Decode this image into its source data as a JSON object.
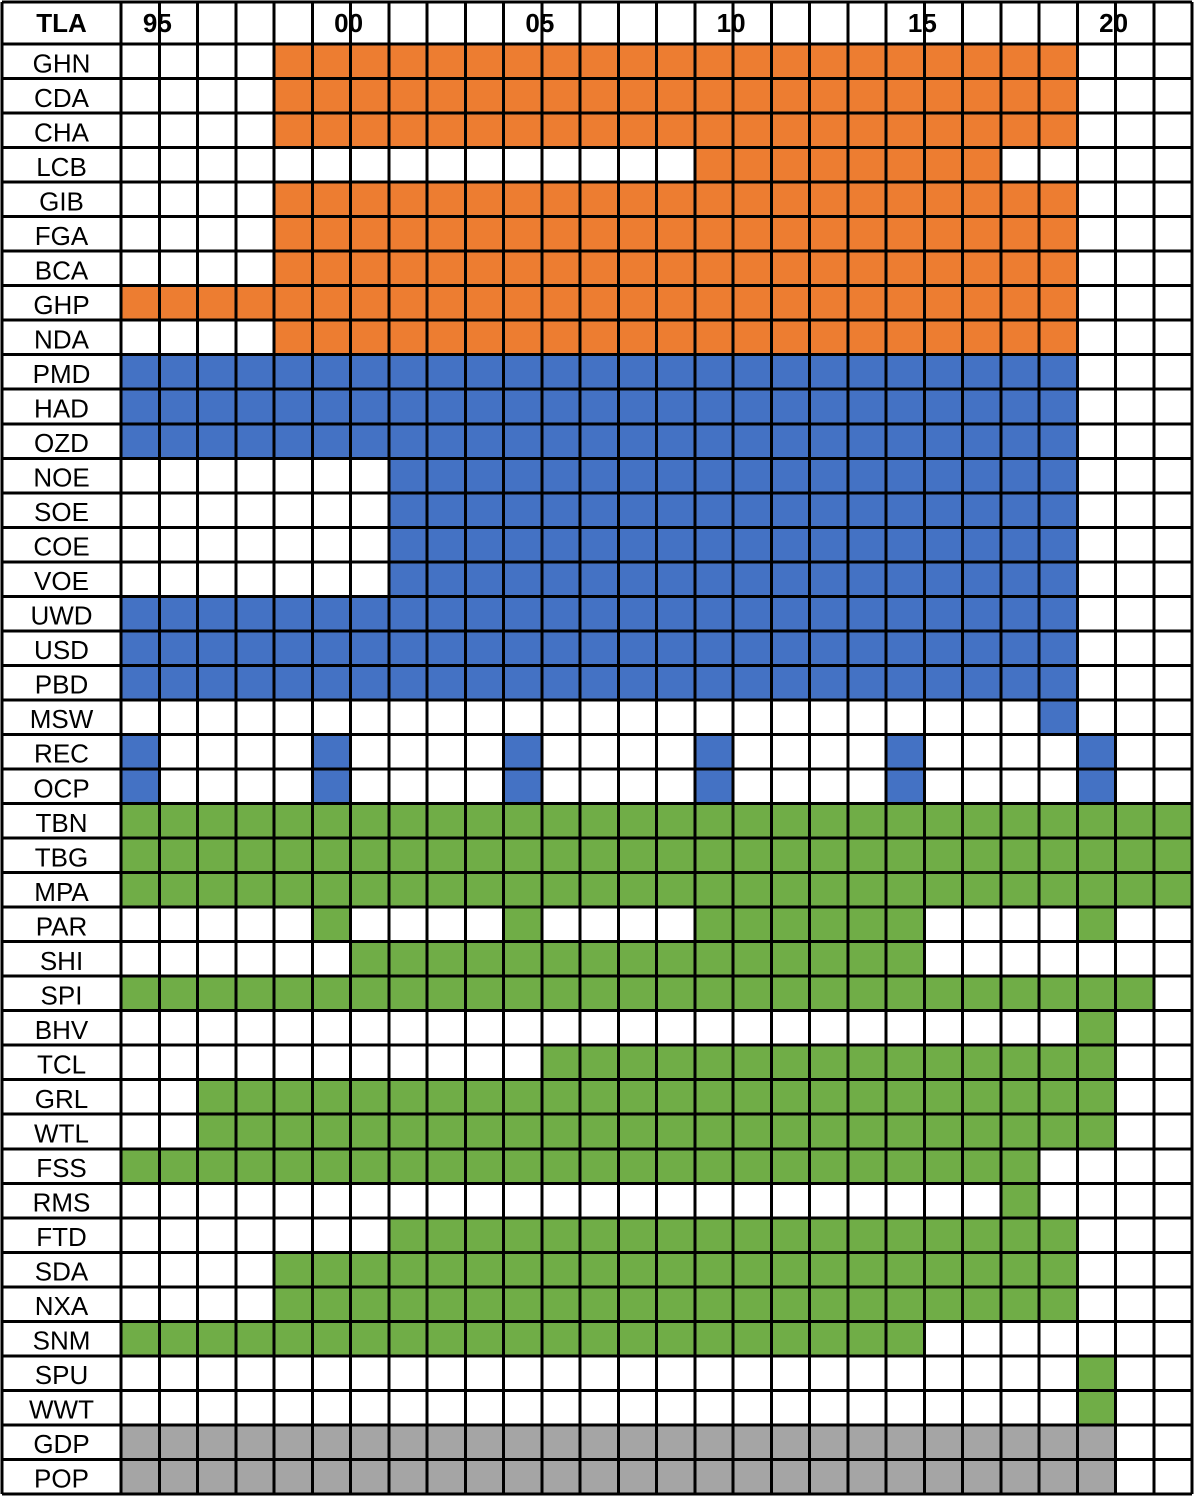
{
  "chart_data": {
    "type": "heatmap",
    "corner_label": "TLA",
    "column_labels": [
      "95",
      "",
      "",
      "",
      "",
      "00",
      "",
      "",
      "",
      "",
      "05",
      "",
      "",
      "",
      "",
      "10",
      "",
      "",
      "",
      "",
      "15",
      "",
      "",
      "",
      "",
      "20",
      "",
      ""
    ],
    "years": [
      1995,
      1996,
      1997,
      1998,
      1999,
      2000,
      2001,
      2002,
      2003,
      2004,
      2005,
      2006,
      2007,
      2008,
      2009,
      2010,
      2011,
      2012,
      2013,
      2014,
      2015,
      2016,
      2017,
      2018,
      2019,
      2020,
      2021,
      2022
    ],
    "colors": {
      "O": "#ED7D31",
      "B": "#4472C4",
      "G": "#70AD47",
      "S": "#A5A5A5",
      "empty": "#FFFFFF"
    },
    "rows": [
      {
        "label": "GHN",
        "cells": "....OOOOOOOOOOOOOOOOOOOOO..."
      },
      {
        "label": "CDA",
        "cells": "....OOOOOOOOOOOOOOOOOOOOO..."
      },
      {
        "label": "CHA",
        "cells": "....OOOOOOOOOOOOOOOOOOOOO..."
      },
      {
        "label": "LCB",
        "cells": "...............OOOOOOOO....."
      },
      {
        "label": "GIB",
        "cells": "....OOOOOOOOOOOOOOOOOOOOO..."
      },
      {
        "label": "FGA",
        "cells": "....OOOOOOOOOOOOOOOOOOOOO..."
      },
      {
        "label": "BCA",
        "cells": "....OOOOOOOOOOOOOOOOOOOOO..."
      },
      {
        "label": "GHP",
        "cells": "OOOOOOOOOOOOOOOOOOOOOOOOO..."
      },
      {
        "label": "NDA",
        "cells": "....OOOOOOOOOOOOOOOOOOOOO..."
      },
      {
        "label": "PMD",
        "cells": "BBBBBBBBBBBBBBBBBBBBBBBBB..."
      },
      {
        "label": "HAD",
        "cells": "BBBBBBBBBBBBBBBBBBBBBBBBB..."
      },
      {
        "label": "OZD",
        "cells": "BBBBBBBBBBBBBBBBBBBBBBBBB..."
      },
      {
        "label": "NOE",
        "cells": ".......BBBBBBBBBBBBBBBBBB..."
      },
      {
        "label": "SOE",
        "cells": ".......BBBBBBBBBBBBBBBBBB..."
      },
      {
        "label": "COE",
        "cells": ".......BBBBBBBBBBBBBBBBBB..."
      },
      {
        "label": "VOE",
        "cells": ".......BBBBBBBBBBBBBBBBBB..."
      },
      {
        "label": "UWD",
        "cells": "BBBBBBBBBBBBBBBBBBBBBBBBB..."
      },
      {
        "label": "USD",
        "cells": "BBBBBBBBBBBBBBBBBBBBBBBBB..."
      },
      {
        "label": "PBD",
        "cells": "BBBBBBBBBBBBBBBBBBBBBBBBB..."
      },
      {
        "label": "MSW",
        "cells": "........................B..."
      },
      {
        "label": "REC",
        "cells": "B....B....B....B....B....B.."
      },
      {
        "label": "OCP",
        "cells": "B....B....B....B....B....B.."
      },
      {
        "label": "TBN",
        "cells": "GGGGGGGGGGGGGGGGGGGGGGGGGGGG"
      },
      {
        "label": "TBG",
        "cells": "GGGGGGGGGGGGGGGGGGGGGGGGGGGG"
      },
      {
        "label": "MPA",
        "cells": "GGGGGGGGGGGGGGGGGGGGGGGGGGGG"
      },
      {
        "label": "PAR",
        "cells": ".....G....G....GGGGGG....G.."
      },
      {
        "label": "SHI",
        "cells": "......GGGGGGGGGGGGGGG......."
      },
      {
        "label": "SPI",
        "cells": "GGGGGGGGGGGGGGGGGGGGGGGGGGG."
      },
      {
        "label": "BHV",
        "cells": ".........................G.."
      },
      {
        "label": "TCL",
        "cells": "...........GGGGGGGGGGGGGGG.."
      },
      {
        "label": "GRL",
        "cells": "..GGGGGGGGGGGGGGGGGGGGGGGG.."
      },
      {
        "label": "WTL",
        "cells": "..GGGGGGGGGGGGGGGGGGGGGGGG.."
      },
      {
        "label": "FSS",
        "cells": "GGGGGGGGGGGGGGGGGGGGGGGG...."
      },
      {
        "label": "RMS",
        "cells": ".......................G...."
      },
      {
        "label": "FTD",
        "cells": ".......GGGGGGGGGGGGGGGGGG..."
      },
      {
        "label": "SDA",
        "cells": "....GGGGGGGGGGGGGGGGGGGGG..."
      },
      {
        "label": "NXA",
        "cells": "....GGGGGGGGGGGGGGGGGGGGG..."
      },
      {
        "label": "SNM",
        "cells": "GGGGGGGGGGGGGGGGGGGGG......."
      },
      {
        "label": "SPU",
        "cells": ".........................G.."
      },
      {
        "label": "WWT",
        "cells": ".........................G.."
      },
      {
        "label": "GDP",
        "cells": "SSSSSSSSSSSSSSSSSSSSSSSSSS.."
      },
      {
        "label": "POP",
        "cells": "SSSSSSSSSSSSSSSSSSSSSSSSSS.."
      }
    ]
  }
}
